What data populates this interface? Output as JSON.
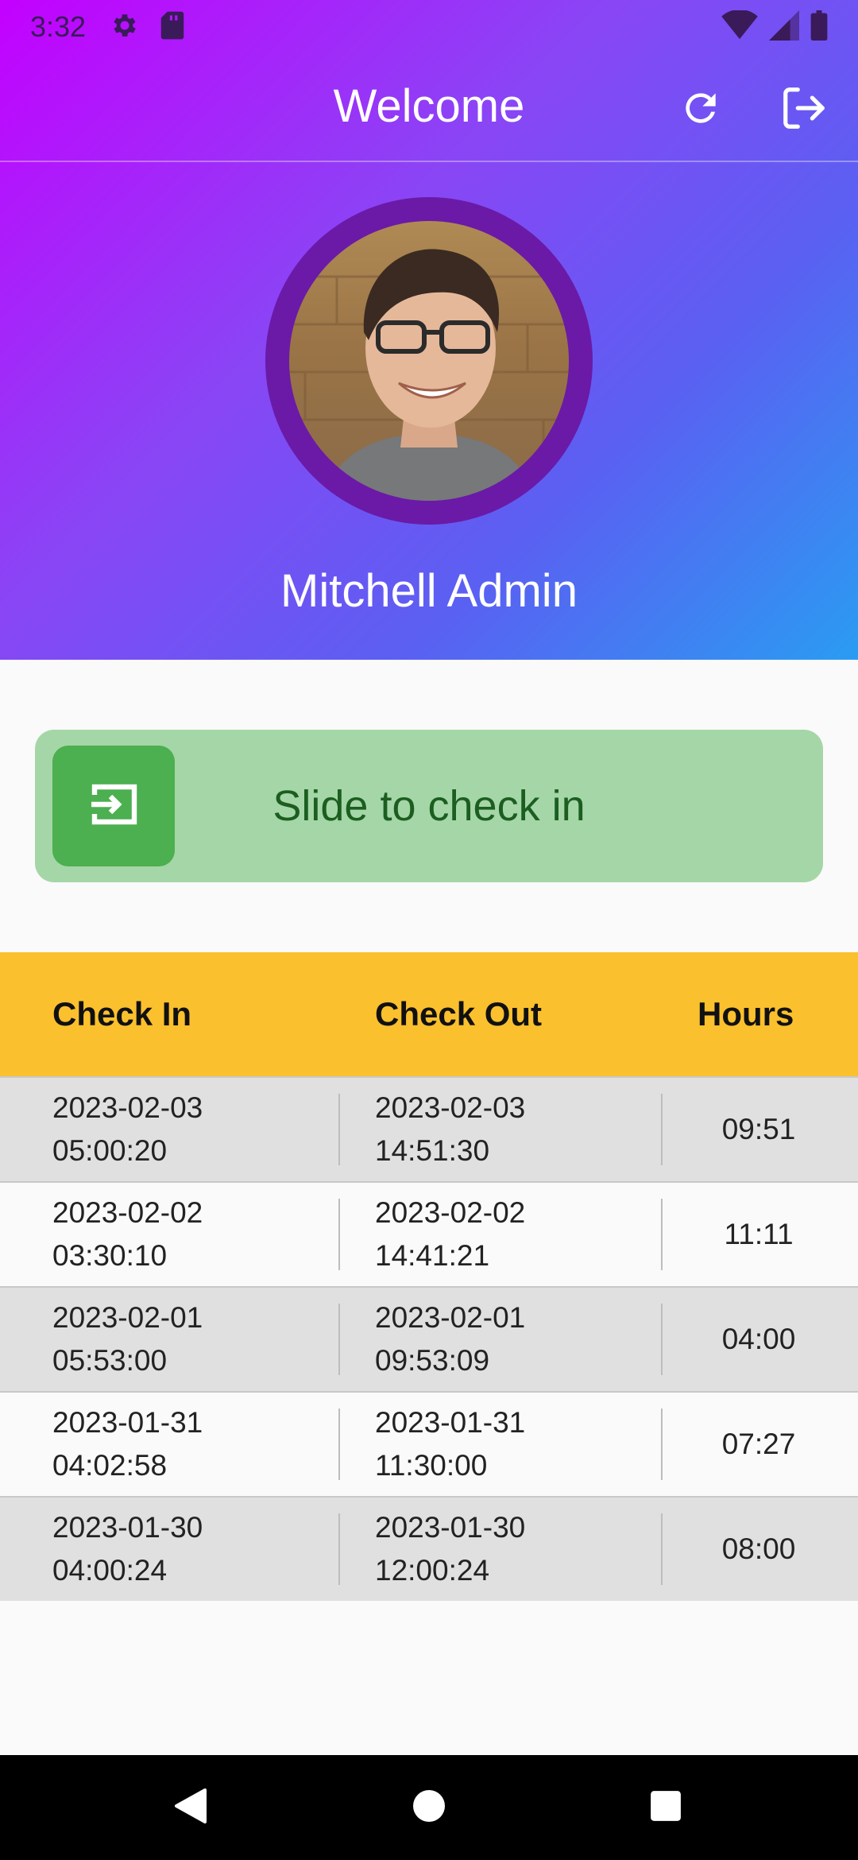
{
  "status_bar": {
    "time": "3:32",
    "icons": [
      "gear-icon",
      "sd-card-icon",
      "wifi-icon",
      "signal-icon",
      "battery-icon"
    ]
  },
  "app_bar": {
    "title": "Welcome",
    "actions": [
      "refresh-icon",
      "logout-icon"
    ]
  },
  "profile": {
    "name": "Mitchell Admin"
  },
  "check_slider": {
    "label": "Slide to check in",
    "icon": "check-in-icon"
  },
  "attendance_table": {
    "headers": [
      "Check In",
      "Check Out",
      "Hours"
    ],
    "rows": [
      {
        "check_in": "2023-02-03\n05:00:20",
        "check_out": "2023-02-03\n14:51:30",
        "hours": "09:51"
      },
      {
        "check_in": "2023-02-02\n03:30:10",
        "check_out": "2023-02-02\n14:41:21",
        "hours": "11:11"
      },
      {
        "check_in": "2023-02-01\n05:53:00",
        "check_out": "2023-02-01\n09:53:09",
        "hours": "04:00"
      },
      {
        "check_in": "2023-01-31\n04:02:58",
        "check_out": "2023-01-31\n11:30:00",
        "hours": "07:27"
      },
      {
        "check_in": "2023-01-30\n04:00:24",
        "check_out": "2023-01-30\n12:00:24",
        "hours": "08:00"
      }
    ]
  },
  "colors": {
    "header_gradient_start": "#c400ff",
    "header_gradient_end": "#2a9cf2",
    "avatar_ring": "#6a1aa6",
    "slider_track": "#a5d6a7",
    "slider_knob": "#4caf50",
    "slider_text": "#1b5e20",
    "table_header": "#fbc02d",
    "row_shaded": "#e0e0e0"
  },
  "nav_bar": [
    "back-icon",
    "home-icon",
    "recents-icon"
  ]
}
